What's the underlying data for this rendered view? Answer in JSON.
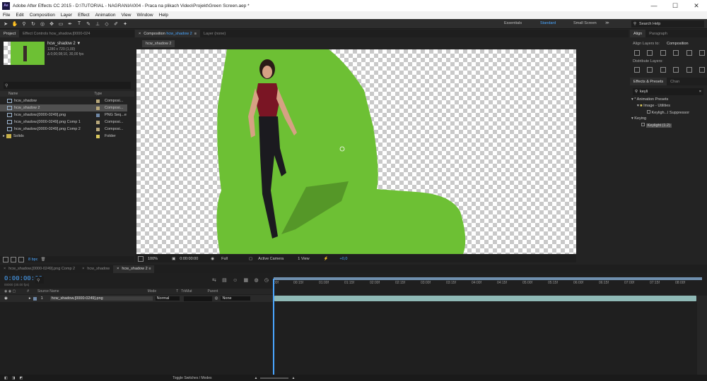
{
  "window": {
    "title": "Adobe After Effects CC 2015 - D:\\TUTORIAL - NAGRANIA\\004 - Praca na plikach Video\\Projekt\\Green Screen.aep *",
    "min": "—",
    "max": "☐",
    "close": "✕"
  },
  "menu": [
    "File",
    "Edit",
    "Composition",
    "Layer",
    "Effect",
    "Animation",
    "View",
    "Window",
    "Help"
  ],
  "workspaces": {
    "essentials": "Essentials",
    "standard": "Standard",
    "small_screen": "Small Screen",
    "menu": "≫"
  },
  "search_help": {
    "placeholder": "Search Help"
  },
  "project": {
    "tab": "Project",
    "effect_controls_tab": "Effect Controls hcw_shadow.[0000-024",
    "selected": {
      "name": "hcw_shadow 2 ▼",
      "dims": "1280 x 720 (1,00)",
      "duration": "Δ 0;00;08;10, 30,00 fps"
    },
    "columns": {
      "name": "Name",
      "type": "Type"
    },
    "items": [
      {
        "name": "hcw_shadow",
        "type": "Composi...",
        "kind": "comp"
      },
      {
        "name": "hcw_shadow 2",
        "type": "Composi...",
        "kind": "comp"
      },
      {
        "name": "hcw_shadow.[0000-0249].png",
        "type": "PNG Seq...e",
        "kind": "png"
      },
      {
        "name": "hcw_shadow.[0000-0249].png Comp 1",
        "type": "Composi...",
        "kind": "comp"
      },
      {
        "name": "hcw_shadow.[0000-0249].png Comp 2",
        "type": "Composi...",
        "kind": "comp"
      },
      {
        "name": "Solids",
        "type": "Folder",
        "kind": "folder"
      }
    ],
    "bpc": "8 bpc"
  },
  "composition": {
    "tab_prefix": "Composition",
    "tab_name": "hcw_shadow 2",
    "tab_menu": "≡",
    "layer_tab": "Layer (none)",
    "subtab": "hcw_shadow 2",
    "footer": {
      "zoom": "100%",
      "timecode": "0:00:00:00",
      "resolution": "Full",
      "camera": "Active Camera",
      "view": "1 View",
      "exposure": "+0,0"
    }
  },
  "align": {
    "tab": "Align",
    "paragraph_tab": "Paragraph",
    "align_to_label": "Align Layers to:",
    "align_to_value": "Composition",
    "distribute_label": "Distribute Layers:"
  },
  "effects": {
    "tab": "Effects & Presets",
    "char_tab": "Chan",
    "search": "keyli",
    "tree": [
      {
        "label": "* Animation Presets",
        "level": 0
      },
      {
        "label": "Image - Utilities",
        "level": 1
      },
      {
        "label": "Keyligh...l Suppressor",
        "level": 2
      },
      {
        "label": "Keying",
        "level": 0
      },
      {
        "label": "Keylight (1.2)",
        "level": 1
      }
    ]
  },
  "timeline": {
    "tabs": [
      "hcw_shadow.[0000-0249].png Comp 2",
      "hcw_shadow",
      "hcw_shadow 2"
    ],
    "timecode": "0:00:00:00",
    "frame_info": "00000 (30.00 fps)",
    "columns": {
      "hash": "#",
      "source": "Source Name",
      "mode": "Mode",
      "t": "T",
      "trkmat": "TrkMat",
      "parent": "Parent"
    },
    "layer": {
      "index": "1",
      "name": "hcw_shadow.[0000-0249].png",
      "mode": "Normal",
      "parent": "None"
    },
    "ruler": [
      "00f",
      "00:15f",
      "01:00f",
      "01:15f",
      "02:00f",
      "02:15f",
      "03:00f",
      "03:15f",
      "04:00f",
      "04:15f",
      "05:00f",
      "05:15f",
      "06:00f",
      "06:15f",
      "07:00f",
      "07:15f",
      "08:00f"
    ],
    "toggle": "Toggle Switches / Modes"
  },
  "colors": {
    "accent": "#4aa6ff",
    "green_screen": "#6dc034",
    "timecode": "#4aa6ff",
    "layer_bar": "#8fb9b6"
  }
}
